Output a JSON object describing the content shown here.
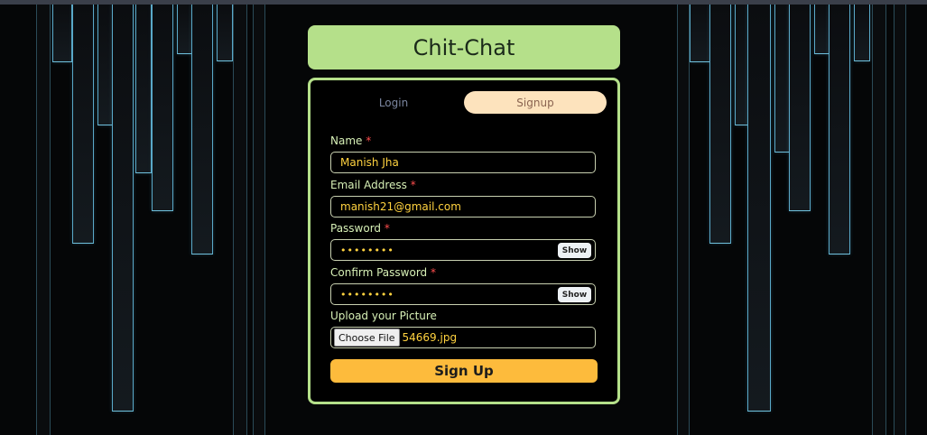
{
  "app": {
    "title": "Chit-Chat"
  },
  "tabs": {
    "login": "Login",
    "signup": "Signup",
    "active": "Signup"
  },
  "form": {
    "name": {
      "label": "Name",
      "required_mark": "*",
      "value": "Manish Jha"
    },
    "email": {
      "label": "Email Address",
      "required_mark": "*",
      "value": "manish21@gmail.com"
    },
    "password": {
      "label": "Password",
      "required_mark": "*",
      "masked_value": "••••••••",
      "show_label": "Show"
    },
    "confirm_password": {
      "label": "Confirm Password",
      "required_mark": "*",
      "masked_value": "••••••••",
      "show_label": "Show"
    },
    "picture": {
      "label": "Upload your Picture",
      "button_label": "Choose File",
      "file_name": "54669.jpg"
    },
    "submit_label": "Sign Up"
  },
  "colors": {
    "accent_green": "#b5e08a",
    "signup_tab": "#fde3bd",
    "submit_button": "#fdbb3c",
    "input_text": "#ffd23f",
    "required": "#ff4d4d"
  }
}
